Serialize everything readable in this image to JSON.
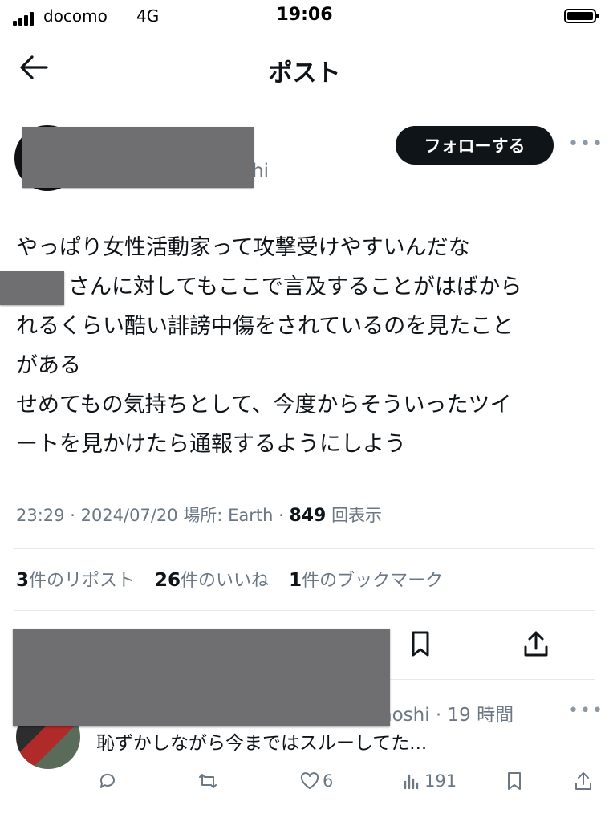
{
  "status_bar": {
    "carrier": "docomo",
    "network": "4G",
    "time": "19:06"
  },
  "header": {
    "title": "ポスト"
  },
  "author": {
    "handle_tail": "hi",
    "follow_label": "フォローする"
  },
  "post": {
    "lines": [
      "やっぱり女性活動家って攻撃受けやすいんだな",
      "さんに対してもここで言及することがはばから",
      "れるくらい酷い誹謗中傷をされているのを見たこと",
      "がある",
      "せめてもの気持ちとして、今度からそういったツイ",
      "ートを見かけたら通報するようにしよう"
    ]
  },
  "meta": {
    "time": "23:29",
    "date": "2024/07/20",
    "location": "場所: Earth",
    "views_count": "849",
    "views_label": "回表示"
  },
  "stats": {
    "reposts_count": "3",
    "reposts_label": "件のリポスト",
    "likes_count": "26",
    "likes_label": "件のいいね",
    "bookmarks_count": "1",
    "bookmarks_label": "件のブックマーク"
  },
  "reply": {
    "handle_tail": "noshi",
    "time_ago": "19 時間",
    "text": "恥ずかしながら今まではスルーしてた...",
    "likes": "6",
    "views": "191"
  },
  "icons": {
    "back": "back-arrow-icon",
    "more": "more-icon",
    "bookmark": "bookmark-icon",
    "share": "share-icon",
    "reply": "reply-icon",
    "repost": "repost-icon",
    "like": "heart-icon",
    "views": "views-icon"
  }
}
